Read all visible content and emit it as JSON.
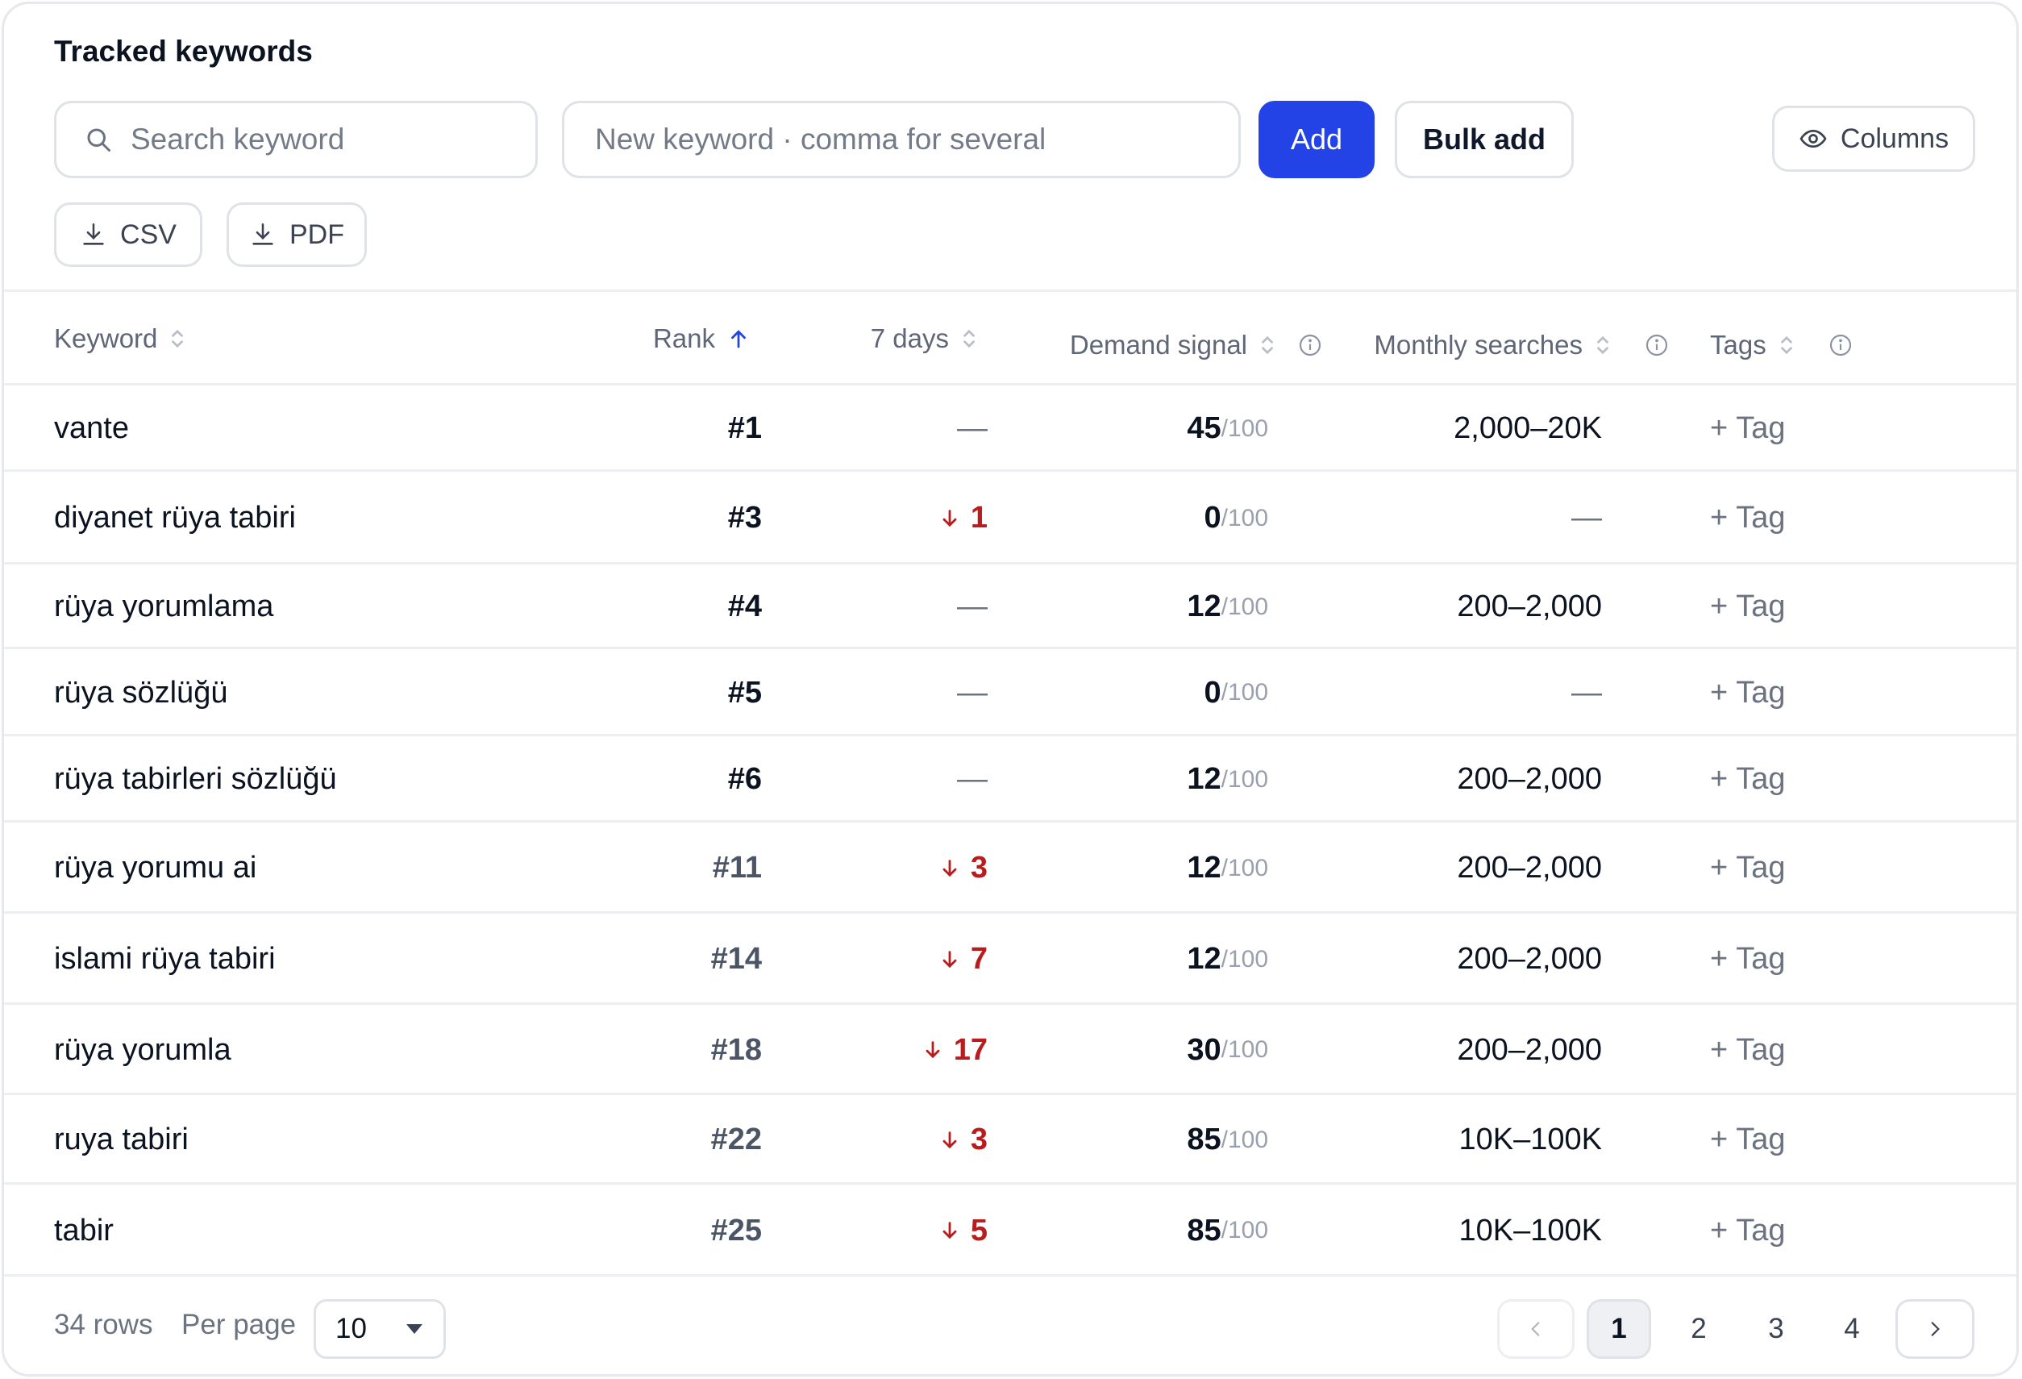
{
  "panel": {
    "title": "Tracked keywords"
  },
  "toolbar": {
    "search_placeholder": "Search keyword",
    "new_keyword_placeholder": "New keyword · comma for several",
    "add_label": "Add",
    "bulk_add_label": "Bulk add",
    "columns_label": "Columns",
    "csv_label": "CSV",
    "pdf_label": "PDF"
  },
  "colors": {
    "accent": "#2443e6",
    "negative": "#b91c1c",
    "muted": "#6b7280"
  },
  "table": {
    "headers": {
      "keyword": "Keyword",
      "rank": "Rank",
      "change": "7 days",
      "demand": "Demand signal",
      "monthly": "Monthly searches",
      "tags": "Tags"
    },
    "demand_denominator": "/100",
    "tag_label": "Tag",
    "rows": [
      {
        "keyword": "vante",
        "rank": "#1",
        "change": "—",
        "change_dir": "none",
        "demand": "45",
        "monthly": "2,000–20K"
      },
      {
        "keyword": "diyanet rüya tabiri",
        "rank": "#3",
        "change": "1",
        "change_dir": "down",
        "demand": "0",
        "monthly": "—"
      },
      {
        "keyword": "rüya yorumlama",
        "rank": "#4",
        "change": "—",
        "change_dir": "none",
        "demand": "12",
        "monthly": "200–2,000"
      },
      {
        "keyword": "rüya sözlüğü",
        "rank": "#5",
        "change": "—",
        "change_dir": "none",
        "demand": "0",
        "monthly": "—"
      },
      {
        "keyword": "rüya tabirleri sözlüğü",
        "rank": "#6",
        "change": "—",
        "change_dir": "none",
        "demand": "12",
        "monthly": "200–2,000"
      },
      {
        "keyword": "rüya yorumu ai",
        "rank": "#11",
        "change": "3",
        "change_dir": "down",
        "demand": "12",
        "monthly": "200–2,000"
      },
      {
        "keyword": "islami rüya tabiri",
        "rank": "#14",
        "change": "7",
        "change_dir": "down",
        "demand": "12",
        "monthly": "200–2,000"
      },
      {
        "keyword": "rüya yorumla",
        "rank": "#18",
        "change": "17",
        "change_dir": "down",
        "demand": "30",
        "monthly": "200–2,000"
      },
      {
        "keyword": "ruya tabiri",
        "rank": "#22",
        "change": "3",
        "change_dir": "down",
        "demand": "85",
        "monthly": "10K–100K"
      },
      {
        "keyword": "tabir",
        "rank": "#25",
        "change": "5",
        "change_dir": "down",
        "demand": "85",
        "monthly": "10K–100K"
      }
    ]
  },
  "footer": {
    "row_count": "34 rows",
    "per_page_label": "Per page",
    "per_page_value": "10",
    "pages": [
      "1",
      "2",
      "3",
      "4"
    ],
    "current_page": "1"
  }
}
